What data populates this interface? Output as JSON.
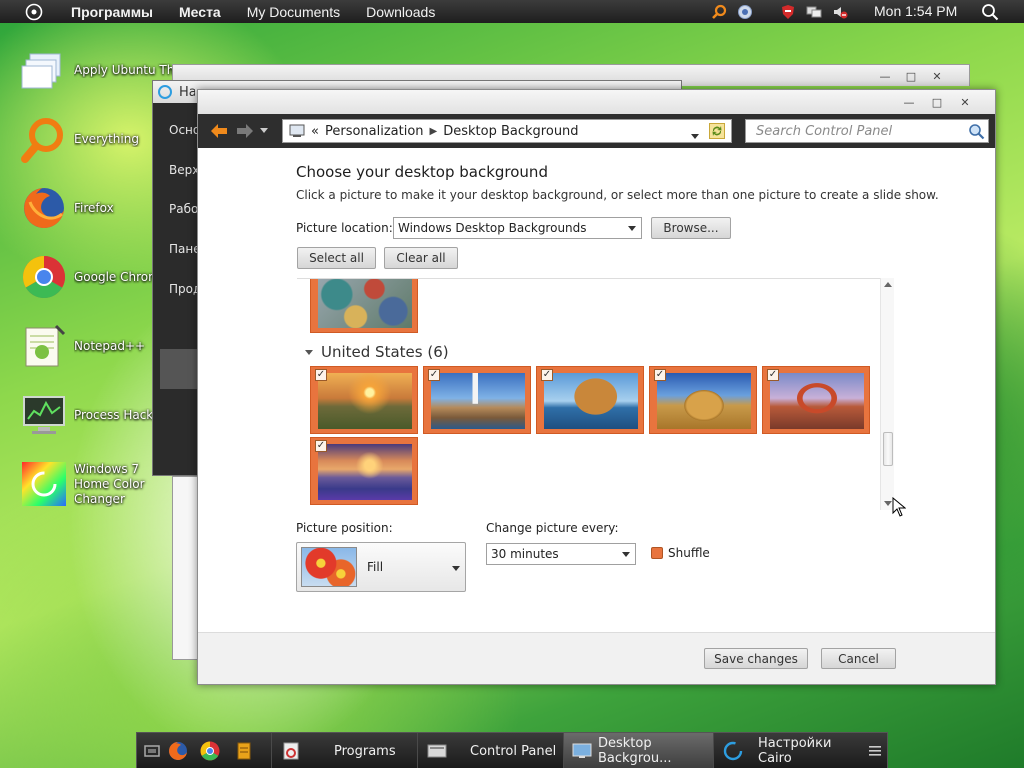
{
  "top_panel": {
    "menu": [
      "Программы",
      "Места",
      "My Documents",
      "Downloads"
    ],
    "clock": "Mon 1:54 PM"
  },
  "desktop_icons": [
    {
      "label": "Apply Ubuntu Theme",
      "icon": "theme-icon"
    },
    {
      "label": "Everything",
      "icon": "search-icon"
    },
    {
      "label": "Firefox",
      "icon": "firefox-icon"
    },
    {
      "label": "Google Chrome",
      "icon": "chrome-icon"
    },
    {
      "label": "Notepad++",
      "icon": "notepad-icon"
    },
    {
      "label": "Process Hacker",
      "icon": "process-hacker-icon"
    },
    {
      "label": "Windows 7 Home Color Changer",
      "icon": "color-changer-icon"
    }
  ],
  "back_window": {
    "title": "Настройки Cairo",
    "nav": [
      "Осно",
      "Верх",
      "Рабо",
      "Пане",
      "Прод"
    ]
  },
  "main_window": {
    "breadcrumb_root": "«",
    "breadcrumb": [
      "Personalization",
      "Desktop Background"
    ],
    "search_placeholder": "Search Control Panel",
    "heading": "Choose your desktop background",
    "subheading": "Click a picture to make it your desktop background, or select more than one picture to create a slide show.",
    "picture_location_label": "Picture location:",
    "picture_location_value": "Windows Desktop Backgrounds",
    "browse_label": "Browse...",
    "select_all_label": "Select all",
    "clear_all_label": "Clear all",
    "group_title": "United States (6)",
    "thumbnails_count": 6,
    "picture_position_label": "Picture position:",
    "picture_position_value": "Fill",
    "change_every_label": "Change picture every:",
    "change_every_value": "30 minutes",
    "shuffle_label": "Shuffle",
    "save_label": "Save changes",
    "cancel_label": "Cancel"
  },
  "taskbar": {
    "tasks": [
      {
        "label": "Programs",
        "icon": "programs-icon"
      },
      {
        "label": "Control Panel",
        "icon": "control-panel-icon"
      },
      {
        "label": "Desktop Backgrou...",
        "icon": "desktop-background-icon",
        "active": true
      },
      {
        "label": "Настройки Cairo",
        "icon": "cairo-icon"
      }
    ]
  },
  "colors": {
    "accent_orange": "#e8743e",
    "toolbar_dark": "#2e2e2e",
    "panel_dark": "#1e1e1e"
  }
}
